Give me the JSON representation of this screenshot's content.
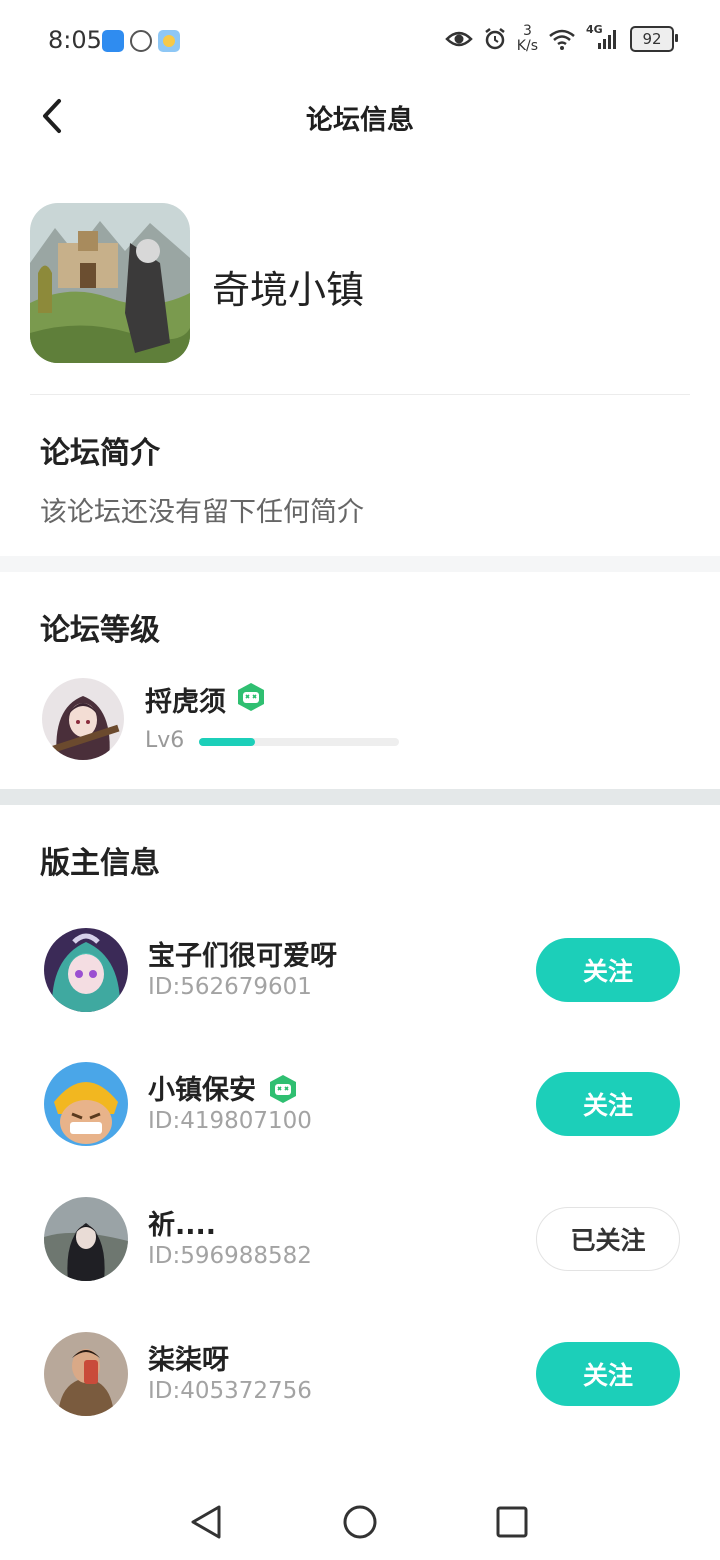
{
  "status_bar": {
    "time": "8:05",
    "net_speed_value": "3",
    "net_speed_unit": "K/s",
    "network_type": "4G",
    "battery": "92"
  },
  "header": {
    "title": "论坛信息"
  },
  "forum": {
    "name": "奇境小镇"
  },
  "intro": {
    "title": "论坛简介",
    "text": "该论坛还没有留下任何简介"
  },
  "level": {
    "title": "论坛等级",
    "user_name": "捋虎须",
    "level_label": "Lv6",
    "progress": 0.28
  },
  "moderators": {
    "title": "版主信息",
    "items": [
      {
        "name": "宝子们很可爱呀",
        "id": "ID:562679601",
        "button": "关注",
        "followed": false,
        "badge": false
      },
      {
        "name": "小镇保安",
        "id": "ID:419807100",
        "button": "关注",
        "followed": false,
        "badge": true
      },
      {
        "name": "祈....",
        "id": "ID:596988582",
        "button": "已关注",
        "followed": true,
        "badge": false
      },
      {
        "name": "柒柒呀",
        "id": "ID:405372756",
        "button": "关注",
        "followed": false,
        "badge": false
      }
    ]
  },
  "colors": {
    "accent": "#1ccfb9",
    "badge_green": "#2fbf71",
    "section_band": "#f5f6f7",
    "section_band_dark": "#e4e8e9"
  }
}
